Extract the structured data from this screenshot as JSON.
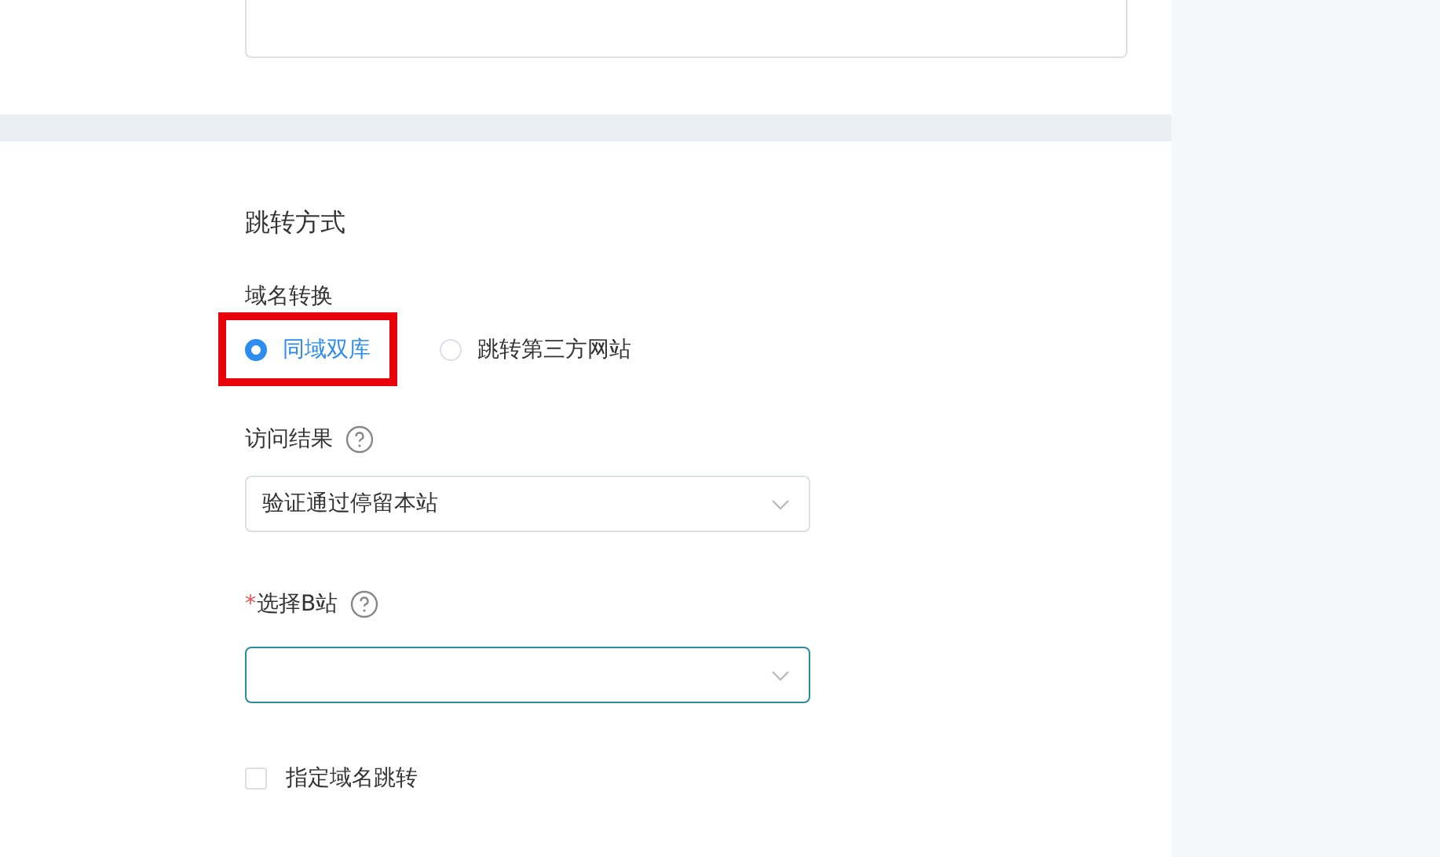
{
  "section_title": "跳转方式",
  "domain_conversion": {
    "label": "域名转换",
    "options": [
      {
        "label": "同域双库",
        "selected": true,
        "highlighted": true
      },
      {
        "label": "跳转第三方网站",
        "selected": false,
        "highlighted": false
      }
    ]
  },
  "visit_result": {
    "label": "访问结果",
    "value": "验证通过停留本站"
  },
  "site_b": {
    "label": "选择B站",
    "required_mark": "*",
    "focused": true
  },
  "specify_domain": {
    "label": "指定域名跳转",
    "checked": false
  }
}
